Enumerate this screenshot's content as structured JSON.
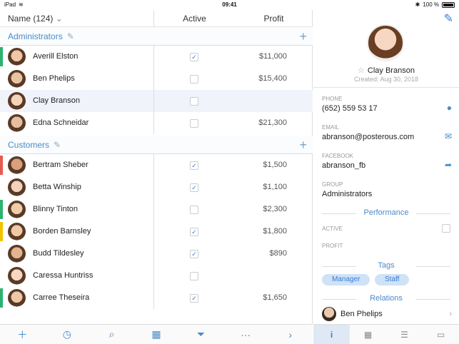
{
  "status": {
    "time": "09:41",
    "left": "iPad",
    "battery": "100 %"
  },
  "list": {
    "header": {
      "name": "Name (124)",
      "active": "Active",
      "profit": "Profit"
    },
    "sections": [
      {
        "title": "Administrators",
        "rows": [
          {
            "name": "Averill Elston",
            "active": true,
            "profit": "$11,000",
            "color": "#2db36f"
          },
          {
            "name": "Ben Phelips",
            "active": false,
            "profit": "$15,400",
            "color": ""
          },
          {
            "name": "Clay Branson",
            "active": false,
            "profit": "",
            "color": ""
          },
          {
            "name": "Edna Schneidar",
            "active": false,
            "profit": "$21,300",
            "color": ""
          }
        ]
      },
      {
        "title": "Customers",
        "rows": [
          {
            "name": "Bertram Sheber",
            "active": true,
            "profit": "$1,500",
            "color": "#e85a4f"
          },
          {
            "name": "Betta Winship",
            "active": true,
            "profit": "$1,100",
            "color": ""
          },
          {
            "name": "Blinny Tinton",
            "active": false,
            "profit": "$2,300",
            "color": "#2db36f"
          },
          {
            "name": "Borden Barnsley",
            "active": true,
            "profit": "$1,800",
            "color": "#f2c200"
          },
          {
            "name": "Budd Tildesley",
            "active": true,
            "profit": "$890",
            "color": ""
          },
          {
            "name": "Caressa Huntriss",
            "active": false,
            "profit": "",
            "color": ""
          },
          {
            "name": "Carree Theseira",
            "active": true,
            "profit": "$1,650",
            "color": "#2db36f"
          }
        ]
      }
    ],
    "toolbar": [
      "plus-icon",
      "clock-icon",
      "search-icon",
      "calendar-icon",
      "filter-icon",
      "more-icon",
      "chevron-right-icon"
    ]
  },
  "detail": {
    "name": "Clay Branson",
    "created": "Created: Aug 30, 2018",
    "fields": [
      {
        "label": "PHONE",
        "value": "(652) 559 53 17"
      },
      {
        "label": "EMAIL",
        "value": "abranson@posterous.com"
      },
      {
        "label": "FACEBOOK",
        "value": "abranson_fb"
      },
      {
        "label": "GROUP",
        "value": "Administrators"
      }
    ],
    "performance": "Performance",
    "active_label": "ACTIVE",
    "profit_label": "PROFIT",
    "tags_title": "Tags",
    "tags": [
      "Manager",
      "Staff"
    ],
    "relations_title": "Relations",
    "relation": "Ben Phelips"
  },
  "colors": {
    "accent": "#4a8ac9"
  }
}
